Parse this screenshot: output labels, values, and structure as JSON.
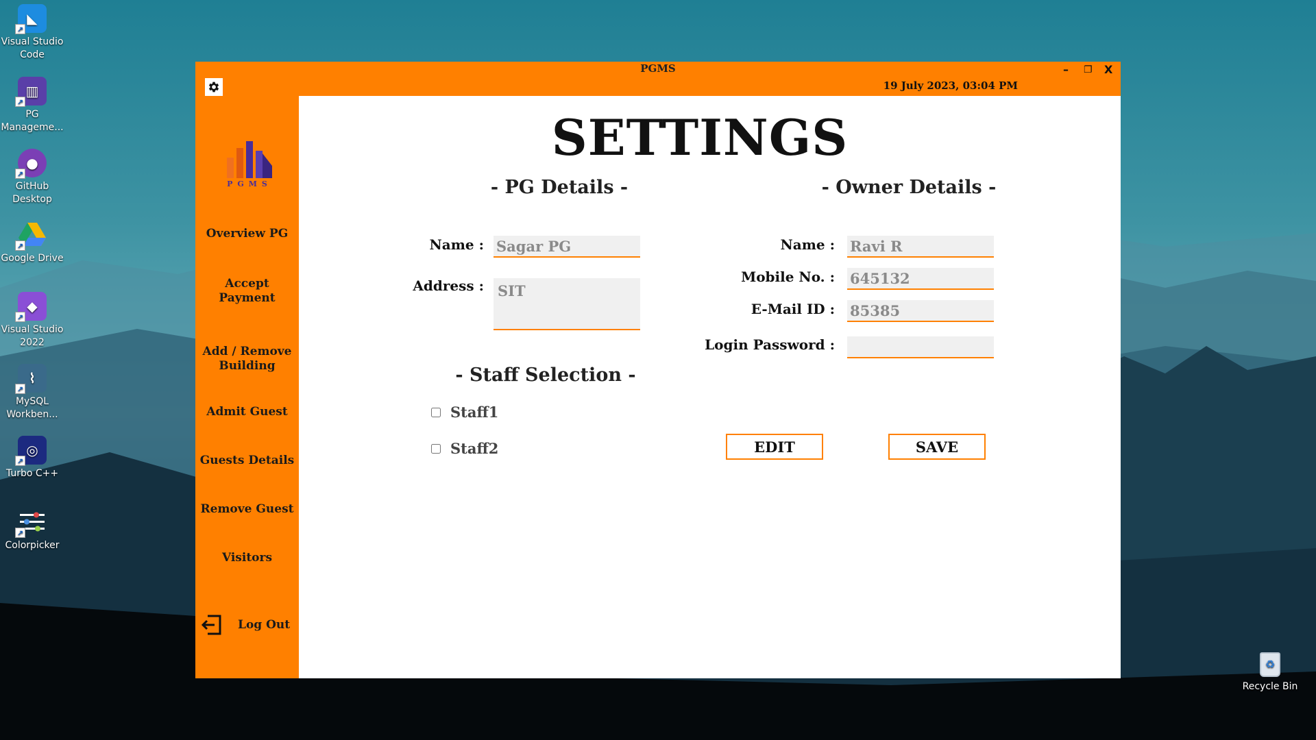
{
  "desktop": {
    "icons": [
      {
        "label_line1": "Visual Studio",
        "label_line2": "Code",
        "icon": "vscode-icon"
      },
      {
        "label_line1": "PG",
        "label_line2": "Manageme...",
        "icon": "pg-management-icon"
      },
      {
        "label_line1": "GitHub",
        "label_line2": "Desktop",
        "icon": "github-desktop-icon"
      },
      {
        "label_line1": "Google Drive",
        "label_line2": "",
        "icon": "google-drive-icon"
      },
      {
        "label_line1": "Visual Studio",
        "label_line2": "2022",
        "icon": "visual-studio-icon"
      },
      {
        "label_line1": "MySQL",
        "label_line2": "Workben...",
        "icon": "mysql-workbench-icon"
      },
      {
        "label_line1": "Turbo C++",
        "label_line2": "",
        "icon": "turbo-cpp-icon"
      },
      {
        "label_line1": "Colorpicker",
        "label_line2": "",
        "icon": "colorpicker-icon"
      }
    ],
    "recycle_bin": "Recycle Bin"
  },
  "window": {
    "title": "PGMS",
    "datetime": "19 July 2023,  03:04 PM",
    "minimize": "–",
    "maximize": "❐",
    "close": "X",
    "accent_color": "#ff8000"
  },
  "sidebar": {
    "logo_text": "PGMS",
    "items": [
      {
        "line1": "Overview PG",
        "line2": ""
      },
      {
        "line1": "Accept",
        "line2": "Payment"
      },
      {
        "line1": "Add / Remove",
        "line2": "Building"
      },
      {
        "line1": "Admit Guest",
        "line2": ""
      },
      {
        "line1": "Guests Details",
        "line2": ""
      },
      {
        "line1": "Remove Guest",
        "line2": ""
      },
      {
        "line1": "Visitors",
        "line2": ""
      }
    ],
    "logout": "Log Out"
  },
  "settings": {
    "title": "SETTINGS",
    "pg_section": "- PG Details -",
    "owner_section": "- Owner Details -",
    "staff_section": "- Staff Selection -",
    "pg": {
      "name_label": "Name :",
      "name_value": "Sagar PG",
      "address_label": "Address :",
      "address_value": "SIT"
    },
    "owner": {
      "name_label": "Name :",
      "name_value": "Ravi R",
      "mobile_label": "Mobile No. :",
      "mobile_value": "645132",
      "email_label": "E-Mail ID :",
      "email_value": "85385",
      "password_label": "Login Password :",
      "password_value": ""
    },
    "staff": [
      {
        "label": "Staff1",
        "checked": false
      },
      {
        "label": "Staff2",
        "checked": false
      }
    ],
    "edit_button": "EDIT",
    "save_button": "SAVE"
  }
}
